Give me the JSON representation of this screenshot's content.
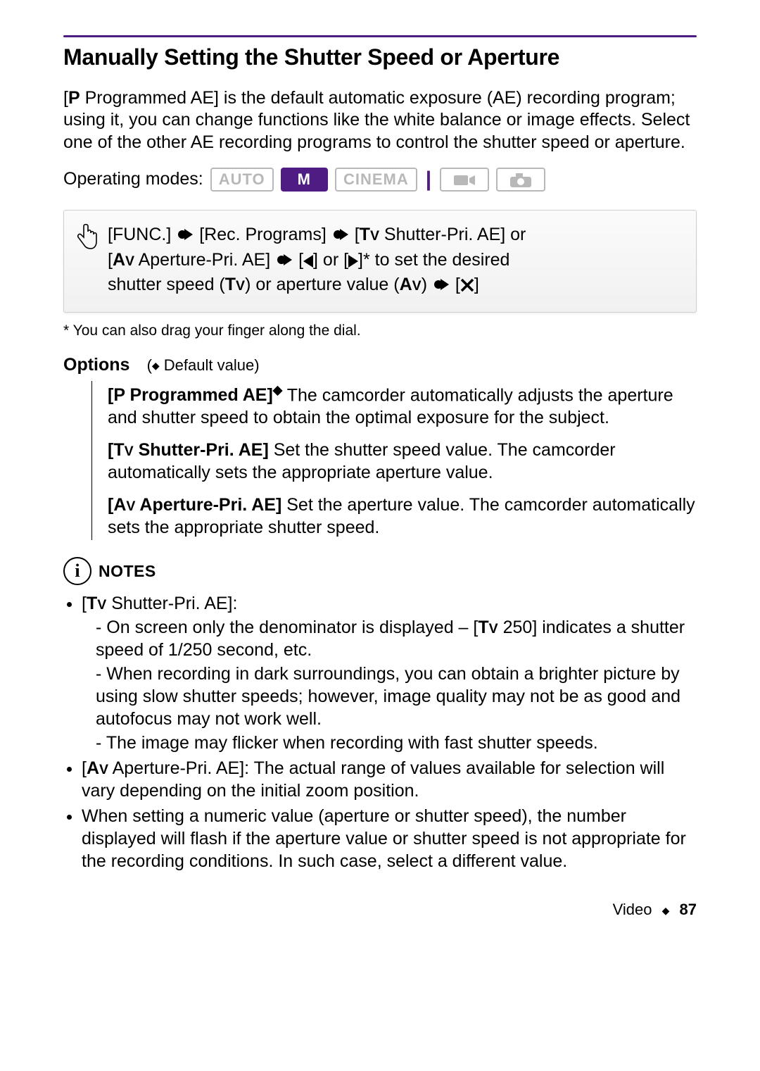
{
  "heading": "Manually Setting the Shutter Speed or Aperture",
  "intro_prefix": "[",
  "intro": " Programmed AE] is the default automatic exposure (AE) recording program; using it, you can change functions like the white balance or image effects. Select one of the other AE recording programs to control the shutter speed or aperture.",
  "intro_p_label": "P",
  "operating_modes_label": "Operating modes:",
  "modes": {
    "auto": "AUTO",
    "m": "M",
    "cinema": "CINEMA"
  },
  "procedure": {
    "func": "[FUNC.]",
    "rec_programs": "[Rec. Programs]",
    "tv_label": " Shutter-Pri. AE] or",
    "av_label_pre": "[",
    "av_label": " Aperture-Pri. AE]",
    "set_desired": "]* to set the desired",
    "line3_pre": "shutter speed (",
    "line3_mid": ") or aperture value (",
    "line3_end": "]"
  },
  "footnote": "*  You can also drag your finger along the dial.",
  "options_label": "Options",
  "options_default": " Default value)",
  "opt_p_title": " Programmed AE]",
  "opt_p_desc": "   The camcorder automatically adjusts the aperture and shutter speed to obtain the optimal exposure for the subject.",
  "opt_tv_title": " Shutter-Pri. AE]",
  "opt_tv_desc": "   Set the shutter speed value. The camcorder automatically sets the appropriate aperture value.",
  "opt_av_title": " Aperture-Pri. AE]",
  "opt_av_desc": "   Set the aperture value. The camcorder automatically sets the appropriate shutter speed.",
  "notes_label": "NOTES",
  "notes": {
    "tv_intro": " Shutter-Pri. AE]:",
    "tv_250": " 250] indicates a shutter speed of 1/250 second, etc.",
    "tv_dash1_pre": "On screen only the denominator is displayed – [",
    "tv_dash2": "When recording in dark surroundings, you can obtain a brighter picture by using slow shutter speeds; however, image quality may not be as good and autofocus may not work well.",
    "tv_dash3": "The image may flicker when recording with fast shutter speeds.",
    "av_line": " Aperture-Pri. AE]: The actual range of values available for selection will vary depending on the initial zoom position.",
    "numeric": "When setting a numeric value (aperture or shutter speed), the number displayed will flash if the aperture value or shutter speed is not appropriate for the recording conditions. In such case, select a different value."
  },
  "footer_section": "Video",
  "footer_page": "87",
  "glyph": {
    "p": "P",
    "tv_t": "T",
    "tv_v": "V",
    "av_a": "A",
    "av_v": "V",
    "or_text": "] or [",
    "open_bracket": "[",
    "close_paren_arrow": ")",
    "diamond": "◆",
    "info": "i",
    "default_open": "("
  }
}
